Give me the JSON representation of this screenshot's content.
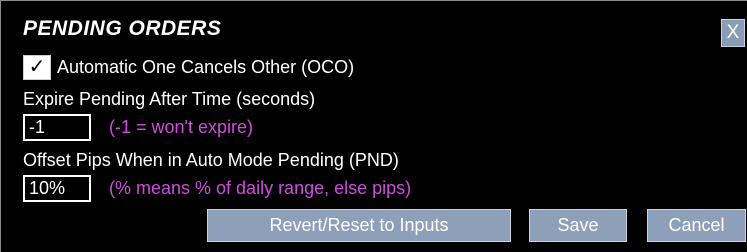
{
  "panel": {
    "title": "PENDING ORDERS",
    "close_label": "X"
  },
  "oco": {
    "checked": true,
    "check_glyph": "✓",
    "label": "Automatic One Cancels Other (OCO)"
  },
  "expire": {
    "label": "Expire Pending After Time (seconds)",
    "value": "-1",
    "hint": "(-1 = won't expire)"
  },
  "offset": {
    "label": "Offset Pips When in Auto Mode Pending (PND)",
    "value": "10%",
    "hint": "(% means % of daily range, else pips)"
  },
  "buttons": {
    "revert_label": "Revert/Reset to Inputs",
    "save_label": "Save",
    "cancel_label": "Cancel"
  },
  "colors": {
    "background": "#000000",
    "button": "#8e9fb9",
    "hint_text": "#d04ce0"
  }
}
